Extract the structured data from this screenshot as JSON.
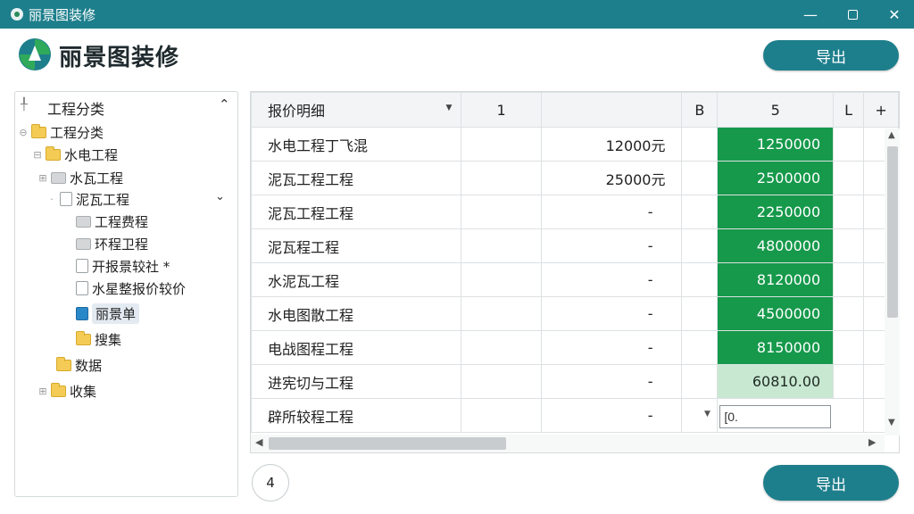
{
  "window": {
    "title": "丽景图装修",
    "minimize": "—",
    "close": "✕"
  },
  "brand": {
    "name": "丽景图装修"
  },
  "actions": {
    "export_top": "导出",
    "export_bottom": "导出"
  },
  "tree": {
    "header": "工程分类",
    "nodes": [
      {
        "label": "工程分类",
        "icon": "folder-yellow"
      },
      {
        "label": "水电工程",
        "icon": "folder-yellow"
      },
      {
        "label": "水瓦工程",
        "icon": "folder-gray"
      },
      {
        "label": "泥瓦工程",
        "icon": "folder-page"
      },
      {
        "label": "工程费程",
        "icon": "folder-gray"
      },
      {
        "label": "环程卫程",
        "icon": "folder-gray"
      },
      {
        "label": "开报景较社 *",
        "icon": "page"
      },
      {
        "label": "水星整报价较价",
        "icon": "page"
      },
      {
        "label": "丽景单",
        "icon": "folder-blue"
      },
      {
        "label": "搜集",
        "icon": "folder-yellow"
      },
      {
        "label": "数据",
        "icon": "folder-yellow"
      },
      {
        "label": "收集",
        "icon": "folder-yellow"
      }
    ]
  },
  "grid": {
    "columns": [
      "报价明细",
      "1",
      "",
      "B",
      "5",
      "L",
      "+"
    ],
    "rows": [
      {
        "item": "水电工程丁飞混",
        "c1": "",
        "amount": "12000元",
        "c3": "",
        "total": "1250000"
      },
      {
        "item": "泥瓦工程工程",
        "c1": "",
        "amount": "25000元",
        "c3": "",
        "total": "2500000"
      },
      {
        "item": "泥瓦工程工程",
        "c1": "",
        "amount": "-",
        "c3": "",
        "total": "2250000"
      },
      {
        "item": "泥瓦程工程",
        "c1": "",
        "amount": "-",
        "c3": "",
        "total": "4800000"
      },
      {
        "item": "水泥瓦工程",
        "c1": "",
        "amount": "-",
        "c3": "",
        "total": "8120000"
      },
      {
        "item": "水电图散工程",
        "c1": "",
        "amount": "-",
        "c3": "",
        "total": "4500000"
      },
      {
        "item": "电战图程工程",
        "c1": "",
        "amount": "-",
        "c3": "",
        "total": "8150000"
      },
      {
        "item": "进宪切与工程",
        "c1": "",
        "amount": "-",
        "c3": "",
        "total": "60810.00"
      },
      {
        "item": "辟所较程工程",
        "c1": "",
        "amount": "-",
        "c3": "",
        "total": ""
      }
    ],
    "edit_value": "[0.",
    "colors": {
      "green": "#16994b",
      "light_green": "#c8e8d2"
    }
  },
  "pager": {
    "page": "4"
  }
}
